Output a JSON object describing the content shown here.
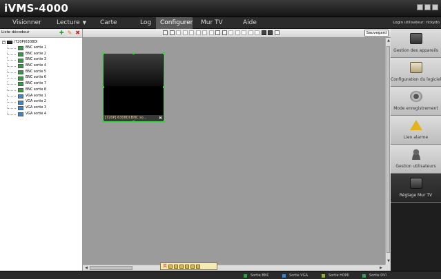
{
  "app": {
    "title": "iVMS-4000"
  },
  "menu": {
    "items": [
      {
        "label": "Visionner"
      },
      {
        "label": "Lecture"
      },
      {
        "label": "Carte"
      },
      {
        "label": "Log"
      },
      {
        "label": "Configurer"
      },
      {
        "label": "Mur TV"
      },
      {
        "label": "Aide"
      }
    ],
    "active": "Configurer",
    "login": "Login utilisateur: rickydo"
  },
  "left_panel": {
    "title": "Liste décodeur",
    "root": "(720P)6308DI",
    "outputs": [
      {
        "label": "BNC sortie 1",
        "type": "bnc"
      },
      {
        "label": "BNC sortie 2",
        "type": "bnc"
      },
      {
        "label": "BNC sortie 3",
        "type": "bnc"
      },
      {
        "label": "BNC sortie 4",
        "type": "bnc"
      },
      {
        "label": "BNC sortie 5",
        "type": "bnc"
      },
      {
        "label": "BNC sortie 6",
        "type": "bnc"
      },
      {
        "label": "BNC sortie 7",
        "type": "bnc"
      },
      {
        "label": "BNC sortie 8",
        "type": "bnc"
      },
      {
        "label": "VGA sortie 1",
        "type": "vga"
      },
      {
        "label": "VGA sortie 2",
        "type": "vga"
      },
      {
        "label": "VGA sortie 3",
        "type": "vga"
      },
      {
        "label": "VGA sortie 4",
        "type": "vga"
      }
    ]
  },
  "toolbar": {
    "save_label": "Sauvegard"
  },
  "wall": {
    "cell_label": "[720P] 6308DI:BNC so..."
  },
  "nav": [
    {
      "label": "Gestion des appareils",
      "icon": "device-icon"
    },
    {
      "label": "Configuration du logiciel",
      "icon": "config-icon"
    },
    {
      "label": "Mode enregistrement",
      "icon": "record-icon"
    },
    {
      "label": "Lien alarme",
      "icon": "alarm-icon"
    },
    {
      "label": "Gestion utilisateurs",
      "icon": "user-icon"
    },
    {
      "label": "Réglage Mur TV",
      "icon": "tvwall-icon"
    }
  ],
  "status_legend": [
    {
      "label": "Sortie BNC",
      "color": "#2e9e3e"
    },
    {
      "label": "Sortie VGA",
      "color": "#3b86d1"
    },
    {
      "label": "Sortie HDMI",
      "color": "#8fb23a"
    },
    {
      "label": "Sortie DVI",
      "color": "#3aa060"
    }
  ],
  "colors": {
    "selection": "#39d339",
    "accent_bg": "#5a5a5a"
  }
}
